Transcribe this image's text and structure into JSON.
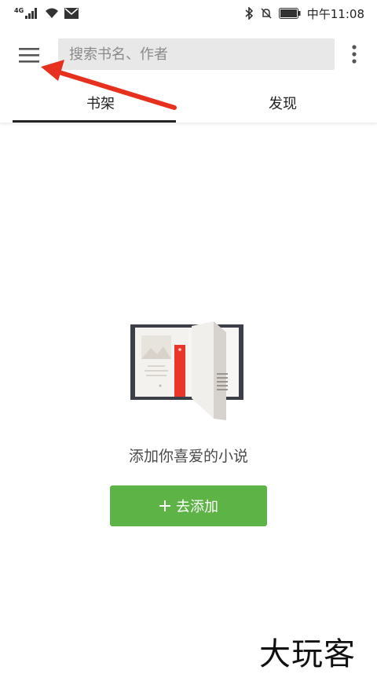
{
  "status_bar": {
    "network_label": "4G",
    "time": "中午11:08",
    "icons": [
      "signal-icon",
      "wifi-icon",
      "mail-icon",
      "bluetooth-icon",
      "bell-off-icon",
      "battery-icon"
    ]
  },
  "appbar": {
    "search_placeholder": "搜索书名、作者",
    "icons": [
      "menu-icon",
      "more-vert-icon"
    ]
  },
  "tabs": [
    {
      "label": "书架",
      "selected": true
    },
    {
      "label": "发现",
      "selected": false
    }
  ],
  "empty_state": {
    "message": "添加你喜爱的小说",
    "add_button_label": "去添加",
    "add_icon": "plus-icon"
  },
  "watermark": "大玩客",
  "colors": {
    "accent_green": "#5db346",
    "annotation_arrow": "#e8301f",
    "search_bg": "#e8e8e8"
  }
}
